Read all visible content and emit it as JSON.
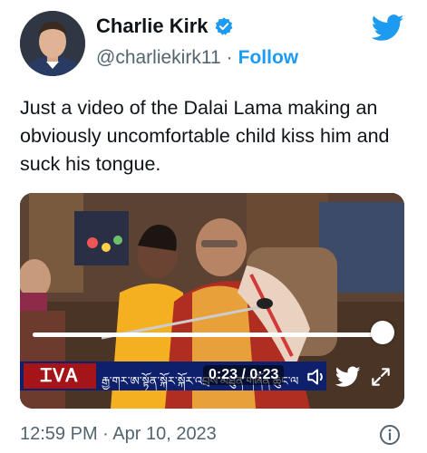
{
  "author": {
    "name": "Charlie Kirk",
    "handle": "@charliekirk11",
    "separator": "·",
    "follow_label": "Follow"
  },
  "tweet": {
    "text": "Just a video of the Dalai Lama making an obviously uncomfortable child kiss him and suck his tongue."
  },
  "video": {
    "time": "0:23 / 0:23",
    "progress": 1.0,
    "banner_logo": "ᏆᏙᎪ",
    "banner_text": "རྒྱ་གར་ཨ་སྟོན་སྐོར་སྐོར་འབྲས་མཐུན་གཞོན་ཆུང་ལ"
  },
  "meta": {
    "timestamp": "12:59 PM · Apr 10, 2023"
  },
  "icons": {
    "verified": "verified-badge-icon",
    "bird": "twitter-bird-icon",
    "volume": "volume-icon",
    "twitter_small": "twitter-bird-icon",
    "fullscreen": "fullscreen-icon",
    "info": "info-icon"
  },
  "colors": {
    "accent": "#1d9bf0",
    "secondary_text": "#536471"
  }
}
